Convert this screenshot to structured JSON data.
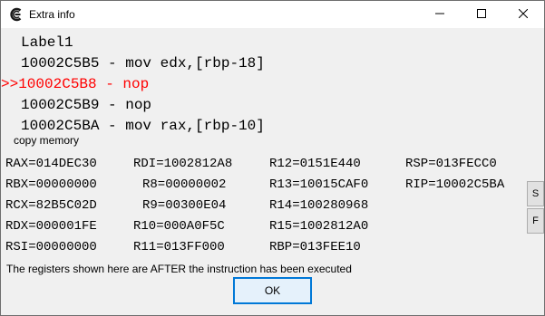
{
  "window": {
    "title": "Extra info"
  },
  "disassembly": {
    "current_marker": ">>",
    "lines": [
      {
        "text": "Label1"
      },
      {
        "text": "10002C5B5 - mov edx,[rbp-18]"
      },
      {
        "text": "10002C5B8 - nop",
        "current": true
      },
      {
        "text": "10002C5B9 - nop"
      },
      {
        "text": "10002C5BA - mov rax,[rbp-10]"
      }
    ]
  },
  "copy_memory_label": "copy memory",
  "registers": {
    "rows": [
      [
        "RAX=014DEC30",
        "RDI=1002812A8",
        "R12=0151E440",
        "RSP=013FECC0"
      ],
      [
        "RBX=00000000",
        "R8=00000002",
        "R13=10015CAF0",
        "RIP=10002C5BA"
      ],
      [
        "RCX=82B5C02D",
        "R9=00300E04",
        "R14=100280968",
        ""
      ],
      [
        "RDX=000001FE",
        "R10=000A0F5C",
        "R15=1002812A0",
        ""
      ],
      [
        "RSI=00000000",
        "R11=013FF000",
        "RBP=013FEE10",
        ""
      ]
    ]
  },
  "side_buttons": {
    "s_label": "S",
    "f_label": "F"
  },
  "note": "The registers shown here are AFTER the instruction has been executed",
  "ok_label": "OK",
  "colors": {
    "current_line": "#ff0000",
    "accent": "#0078d7"
  },
  "icons": {
    "app": "cheat-engine-icon",
    "minimize": "minimize-icon",
    "maximize": "maximize-icon",
    "close": "close-icon"
  }
}
